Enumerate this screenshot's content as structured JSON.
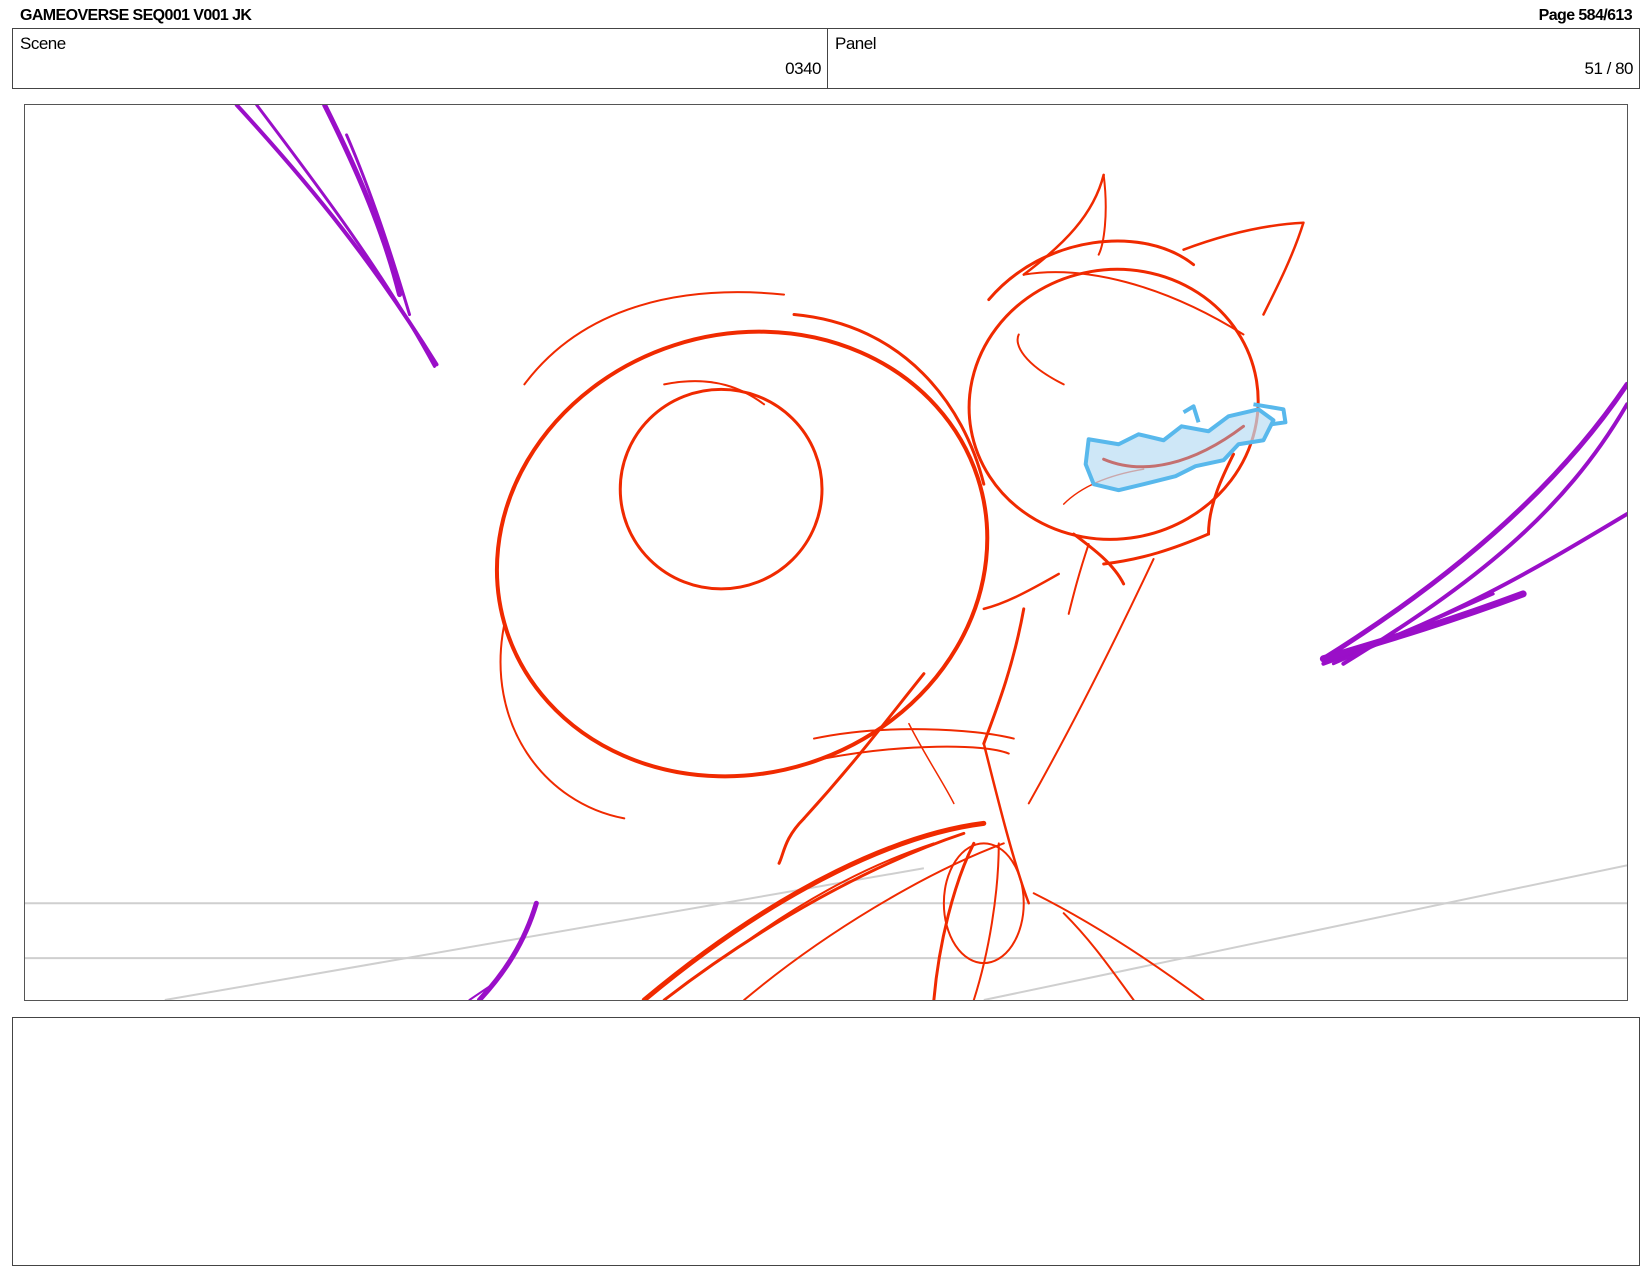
{
  "header": {
    "title": "GAMEOVERSE SEQ001 V001 JK",
    "page": "Page 584/613"
  },
  "scene": {
    "label": "Scene",
    "value": "0340"
  },
  "panel": {
    "label": "Panel",
    "value": "51 / 80"
  },
  "colors": {
    "sketch_red": "#f02a00",
    "effect_purple": "#9a0fc8",
    "highlight_blue": "#58b8ec",
    "guide_gray": "#cfcfcf"
  },
  "notes": {
    "text": ""
  }
}
